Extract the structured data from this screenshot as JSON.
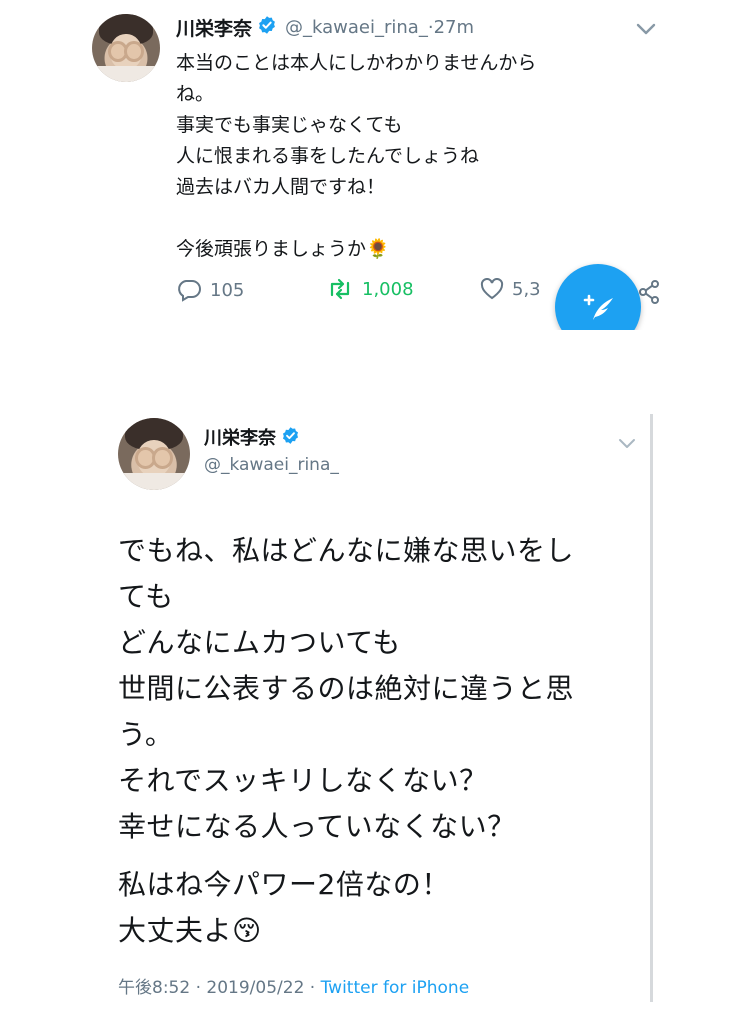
{
  "top_tweet": {
    "name": "川栄李奈",
    "handle": "@_kawaei_rina_",
    "time_separator": " · ",
    "time": "27m",
    "lines": [
      "本当のことは本人にしかわかりませんから",
      "ね。",
      "事実でも事実じゃなくても",
      "人に恨まれる事をしたんでしょうね",
      "過去はバカ人間ですね！",
      "",
      "今後頑張りましょうか🌻"
    ],
    "reply_count": "105",
    "retweet_count": "1,008",
    "like_count": "5,3",
    "colors": {
      "retweet": "#17bf63",
      "fab": "#1da1f2",
      "verified": "#1da1f2"
    },
    "icons": [
      "verified-badge-icon",
      "chevron-down-icon",
      "reply-icon",
      "retweet-icon",
      "like-icon",
      "share-icon",
      "compose-icon"
    ]
  },
  "bottom_tweet": {
    "name": "川栄李奈",
    "handle": "@_kawaei_rina_",
    "paragraphs": [
      [
        "でもね、私はどんなに嫌な思いをし",
        "ても",
        "どんなにムカついても",
        "世間に公表するのは絶対に違うと思",
        "う。",
        "それでスッキリしなくない？",
        "幸せになる人っていなくない？"
      ],
      [
        "私はね今パワー2倍なの！",
        "大丈夫よ😚"
      ]
    ],
    "time": "午後8:52",
    "date": "2019/05/22",
    "separator": " · ",
    "source": "Twitter for iPhone"
  }
}
